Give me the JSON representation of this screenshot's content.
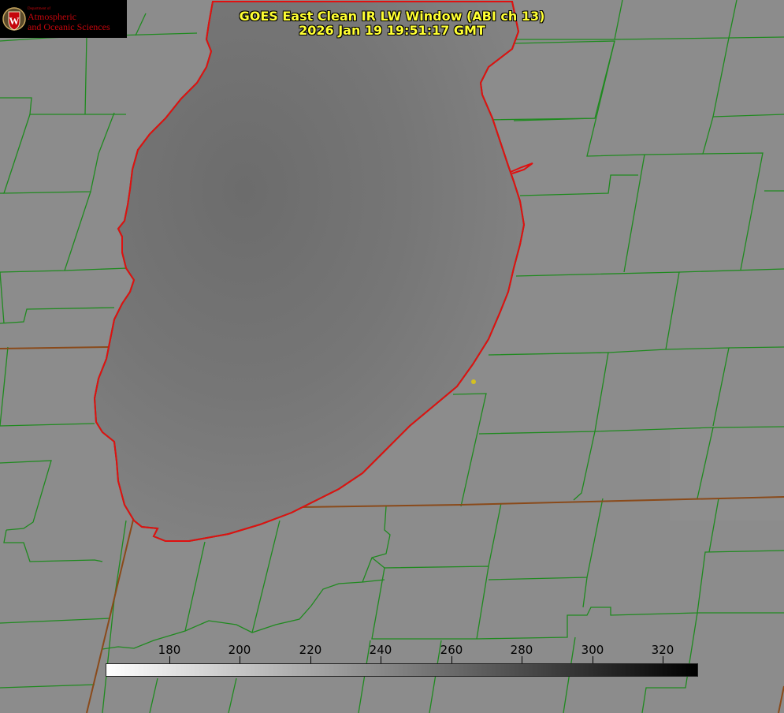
{
  "title_line1": "GOES East Clean IR LW Window (ABI ch 13)",
  "title_line2": "2026 Jan 19 19:51:17 GMT",
  "logo": {
    "dept_small": "Department of",
    "line1": "Atmospheric",
    "line2": "and Oceanic Sciences",
    "seal_letter": "W"
  },
  "colors": {
    "background_land": "#8c8c8c",
    "lake": "#6f6f6f",
    "county_lines": "#1f8a1f",
    "coastline": "#e01010",
    "state_lines": "#8a4a1a",
    "title": "#ffff33",
    "marker": "#d4c020"
  },
  "colorbar": {
    "min": 162,
    "max": 330,
    "ticks": [
      "180",
      "200",
      "220",
      "240",
      "260",
      "280",
      "300",
      "320"
    ]
  }
}
